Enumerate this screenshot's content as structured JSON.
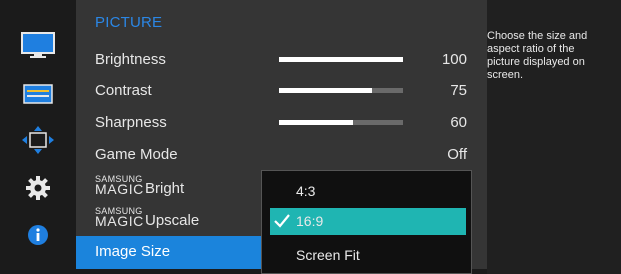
{
  "menu": {
    "title": "PICTURE",
    "items": [
      {
        "label": "Brightness",
        "value": "100",
        "level": 1.0
      },
      {
        "label": "Contrast",
        "value": "75",
        "level": 0.75
      },
      {
        "label": "Sharpness",
        "value": "60",
        "level": 0.6
      },
      {
        "label": "Game Mode",
        "value": "Off"
      },
      {
        "brand_small": "SAMSUNG",
        "brand_magic": "MAGIC",
        "label": "Bright"
      },
      {
        "brand_small": "SAMSUNG",
        "brand_magic": "MAGIC",
        "label": "Upscale"
      },
      {
        "label": "Image Size",
        "selected": true
      }
    ]
  },
  "popup": {
    "options": [
      {
        "label": "4:3",
        "selected": false
      },
      {
        "label": "16:9",
        "selected": true
      },
      {
        "label": "Screen Fit",
        "selected": false
      }
    ]
  },
  "help": {
    "lines": [
      "Choose the size and",
      "aspect ratio of the",
      "picture displayed on",
      "screen."
    ]
  },
  "sidebar": {
    "icons": [
      "picture-icon",
      "onscreen-display-icon",
      "position-icon",
      "settings-gear-icon",
      "info-icon"
    ]
  },
  "colors": {
    "accent_blue": "#2b87e6",
    "selected_row": "#1b84dc",
    "selected_option": "#1fb5b2"
  }
}
